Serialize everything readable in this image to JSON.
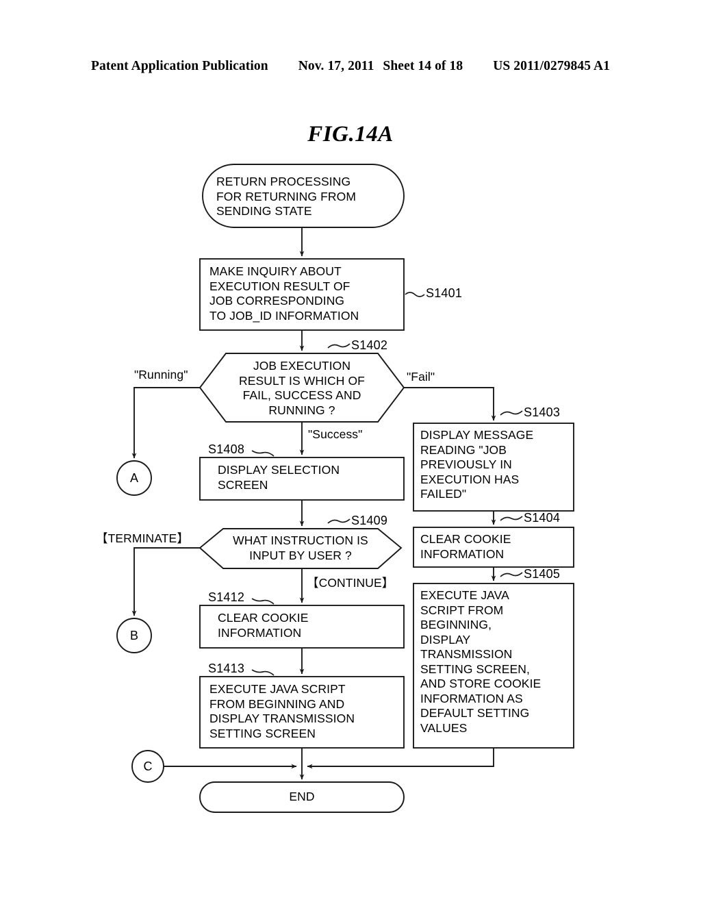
{
  "header": {
    "publication": "Patent Application Publication",
    "date": "Nov. 17, 2011",
    "sheet": "Sheet 14 of 18",
    "patent_number": "US 2011/0279845 A1"
  },
  "figure": {
    "title": "FIG.14A"
  },
  "flowchart": {
    "nodes": {
      "start": {
        "shape": "terminator",
        "text": "RETURN PROCESSING\nFOR RETURNING FROM\nSENDING STATE"
      },
      "s1401": {
        "shape": "process",
        "step": "S1401",
        "text": "MAKE INQUIRY ABOUT\nEXECUTION RESULT OF\nJOB CORRESPONDING\nTO JOB_ID INFORMATION"
      },
      "s1402": {
        "shape": "decision",
        "step": "S1402",
        "text": "JOB EXECUTION\nRESULT IS WHICH OF\nFAIL, SUCCESS AND\nRUNNING ?"
      },
      "s1403": {
        "shape": "process",
        "step": "S1403",
        "text": "DISPLAY MESSAGE\nREADING \"JOB\nPREVIOUSLY IN\nEXECUTION HAS\nFAILED\""
      },
      "s1404": {
        "shape": "process",
        "step": "S1404",
        "text": "CLEAR COOKIE\nINFORMATION"
      },
      "s1405": {
        "shape": "process",
        "step": "S1405",
        "text": "EXECUTE JAVA\nSCRIPT FROM\nBEGINNING,\nDISPLAY\nTRANSMISSION\nSETTING SCREEN,\nAND STORE COOKIE\nINFORMATION AS\nDEFAULT SETTING\nVALUES"
      },
      "s1408": {
        "shape": "process",
        "step": "S1408",
        "text": "DISPLAY SELECTION\nSCREEN"
      },
      "s1409": {
        "shape": "decision",
        "step": "S1409",
        "text": "WHAT INSTRUCTION IS\nINPUT BY USER ?"
      },
      "s1412": {
        "shape": "process",
        "step": "S1412",
        "text": "CLEAR COOKIE\nINFORMATION"
      },
      "s1413": {
        "shape": "process",
        "step": "S1413",
        "text": "EXECUTE JAVA SCRIPT\nFROM BEGINNING AND\nDISPLAY TRANSMISSION\nSETTING SCREEN"
      },
      "end": {
        "shape": "terminator",
        "text": "END"
      }
    },
    "connectors": {
      "a": "A",
      "b": "B",
      "c": "C"
    },
    "edge_labels": {
      "running": "\"Running\"",
      "fail": "\"Fail\"",
      "success": "\"Success\"",
      "terminate": "【TERMINATE】",
      "continue": "【CONTINUE】"
    }
  },
  "colors": {
    "stroke": "#1a1a1a",
    "background": "#ffffff",
    "text": "#000000"
  }
}
